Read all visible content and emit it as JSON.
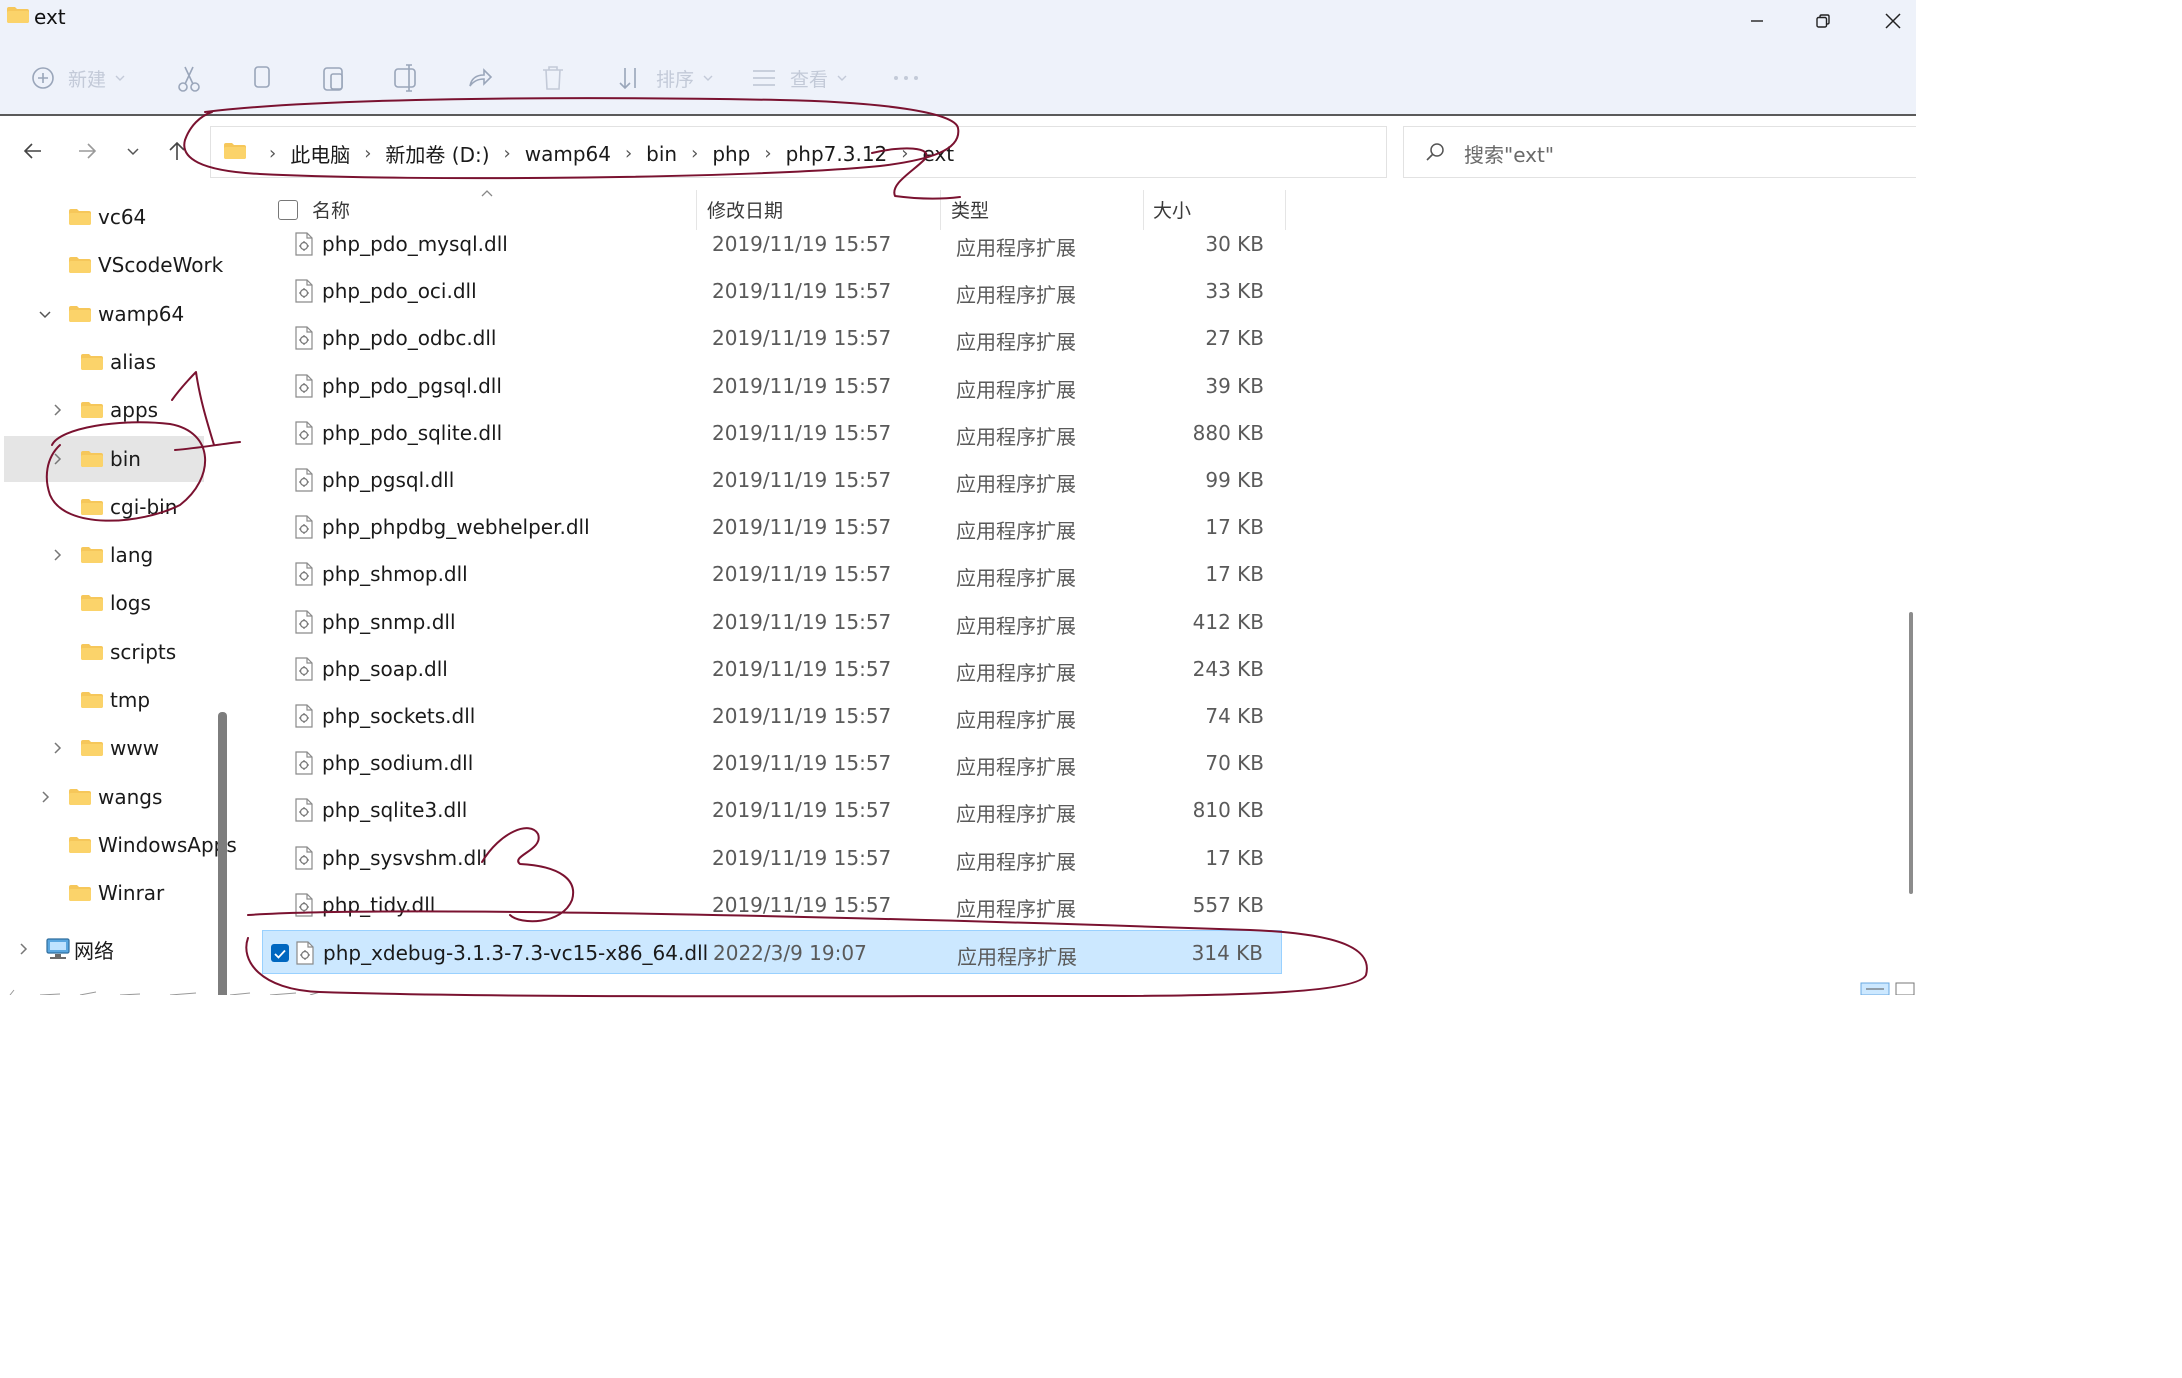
{
  "window": {
    "title": "ext",
    "controls": [
      "minimize",
      "restore",
      "close"
    ]
  },
  "toolbar": {
    "new_label": "新建",
    "sort_label": "排序",
    "view_label": "查看",
    "icons": [
      "cut-icon",
      "copy-icon",
      "paste-icon",
      "rename-icon",
      "share-icon",
      "delete-icon",
      "more-icon"
    ]
  },
  "address": {
    "crumbs": [
      "此电脑",
      "新加卷 (D:)",
      "wamp64",
      "bin",
      "php",
      "php7.3.12",
      "ext"
    ]
  },
  "search": {
    "placeholder": "搜索\"ext\""
  },
  "nav": {
    "items": [
      {
        "label": "vc64",
        "expander": "none",
        "indent": 1
      },
      {
        "label": "VScodeWork",
        "expander": "none",
        "indent": 1
      },
      {
        "label": "wamp64",
        "expander": "expanded",
        "indent": 1
      },
      {
        "label": "alias",
        "expander": "none",
        "indent": 2
      },
      {
        "label": "apps",
        "expander": "collapsed",
        "indent": 2
      },
      {
        "label": "bin",
        "expander": "collapsed",
        "indent": 2,
        "selected": true
      },
      {
        "label": "cgi-bin",
        "expander": "none",
        "indent": 2
      },
      {
        "label": "lang",
        "expander": "collapsed",
        "indent": 2
      },
      {
        "label": "logs",
        "expander": "none",
        "indent": 2
      },
      {
        "label": "scripts",
        "expander": "none",
        "indent": 2
      },
      {
        "label": "tmp",
        "expander": "none",
        "indent": 2
      },
      {
        "label": "www",
        "expander": "collapsed",
        "indent": 2
      },
      {
        "label": "wangs",
        "expander": "collapsed",
        "indent": 1
      },
      {
        "label": "WindowsApps",
        "expander": "none",
        "indent": 1
      },
      {
        "label": "Winrar",
        "expander": "none",
        "indent": 1
      }
    ],
    "network_label": "网络"
  },
  "columns": {
    "name": "名称",
    "date": "修改日期",
    "type": "类型",
    "size": "大小"
  },
  "files": [
    {
      "name": "php_pdo_mysql.dll",
      "date": "2019/11/19 15:57",
      "type": "应用程序扩展",
      "size": "30 KB"
    },
    {
      "name": "php_pdo_oci.dll",
      "date": "2019/11/19 15:57",
      "type": "应用程序扩展",
      "size": "33 KB"
    },
    {
      "name": "php_pdo_odbc.dll",
      "date": "2019/11/19 15:57",
      "type": "应用程序扩展",
      "size": "27 KB"
    },
    {
      "name": "php_pdo_pgsql.dll",
      "date": "2019/11/19 15:57",
      "type": "应用程序扩展",
      "size": "39 KB"
    },
    {
      "name": "php_pdo_sqlite.dll",
      "date": "2019/11/19 15:57",
      "type": "应用程序扩展",
      "size": "880 KB"
    },
    {
      "name": "php_pgsql.dll",
      "date": "2019/11/19 15:57",
      "type": "应用程序扩展",
      "size": "99 KB"
    },
    {
      "name": "php_phpdbg_webhelper.dll",
      "date": "2019/11/19 15:57",
      "type": "应用程序扩展",
      "size": "17 KB"
    },
    {
      "name": "php_shmop.dll",
      "date": "2019/11/19 15:57",
      "type": "应用程序扩展",
      "size": "17 KB"
    },
    {
      "name": "php_snmp.dll",
      "date": "2019/11/19 15:57",
      "type": "应用程序扩展",
      "size": "412 KB"
    },
    {
      "name": "php_soap.dll",
      "date": "2019/11/19 15:57",
      "type": "应用程序扩展",
      "size": "243 KB"
    },
    {
      "name": "php_sockets.dll",
      "date": "2019/11/19 15:57",
      "type": "应用程序扩展",
      "size": "74 KB"
    },
    {
      "name": "php_sodium.dll",
      "date": "2019/11/19 15:57",
      "type": "应用程序扩展",
      "size": "70 KB"
    },
    {
      "name": "php_sqlite3.dll",
      "date": "2019/11/19 15:57",
      "type": "应用程序扩展",
      "size": "810 KB"
    },
    {
      "name": "php_sysvshm.dll",
      "date": "2019/11/19 15:57",
      "type": "应用程序扩展",
      "size": "17 KB"
    },
    {
      "name": "php_tidy.dll",
      "date": "2019/11/19 15:57",
      "type": "应用程序扩展",
      "size": "557 KB"
    },
    {
      "name": "php_xdebug-3.1.3-7.3-vc15-x86_64.dll",
      "date": "2022/3/9 19:07",
      "type": "应用程序扩展",
      "size": "314 KB",
      "selected": true
    }
  ],
  "colors": {
    "chrome_bg": "#eef2fa",
    "selection_bg": "#cce8ff",
    "selection_border": "#99d1ff",
    "accent": "#0067c0",
    "folder": "#f6c75a",
    "annotation_ink": "#7a1230"
  }
}
